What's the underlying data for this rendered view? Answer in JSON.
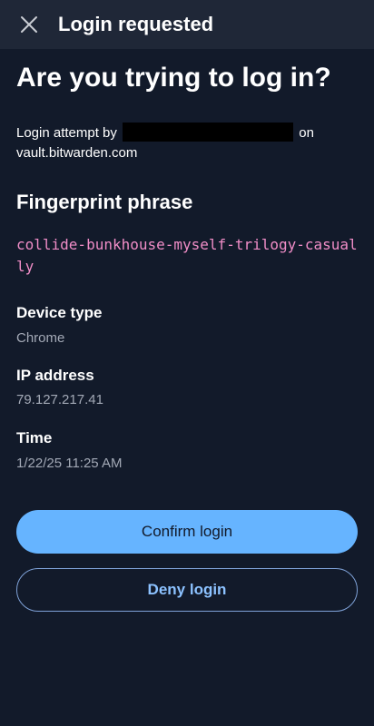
{
  "header": {
    "title": "Login requested",
    "close_icon": "close-icon"
  },
  "main": {
    "heading": "Are you trying to log in?",
    "attempt_prefix": "Login attempt by",
    "attempt_suffix": "on",
    "attempt_domain": "vault.bitwarden.com",
    "fingerprint_title": "Fingerprint phrase",
    "fingerprint_phrase": "collide-bunkhouse-myself-trilogy-casually",
    "fields": [
      {
        "label": "Device type",
        "value": "Chrome"
      },
      {
        "label": "IP address",
        "value": "79.127.217.41"
      },
      {
        "label": "Time",
        "value": "1/22/25 11:25 AM"
      }
    ]
  },
  "actions": {
    "confirm_label": "Confirm login",
    "deny_label": "Deny login"
  },
  "colors": {
    "background": "#121a2a",
    "topbar": "#1f2737",
    "accent": "#66b4ff",
    "phrase": "#f08dc7"
  }
}
